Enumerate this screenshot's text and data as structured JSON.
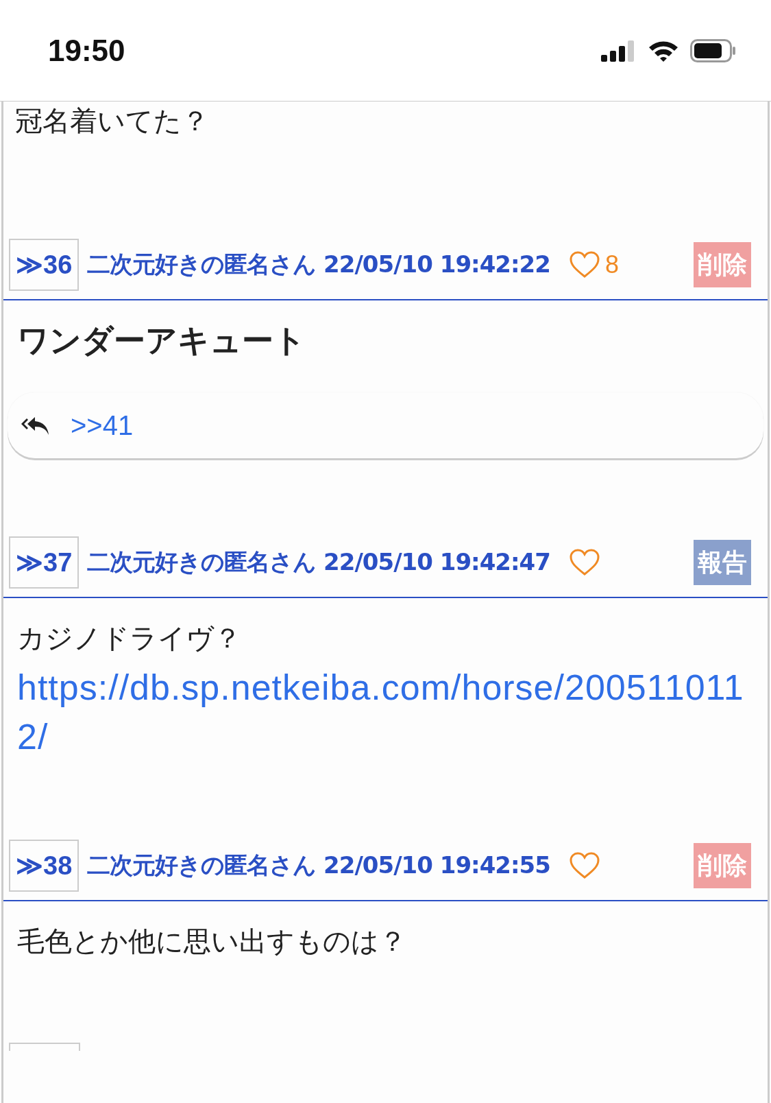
{
  "status_bar": {
    "time": "19:50"
  },
  "previous_post_tail": {
    "text": "冠名着いてた？"
  },
  "posts": [
    {
      "number": "≫36",
      "name": "二次元好きの匿名さん",
      "datetime": "22/05/10 19:42:22",
      "likes": "8",
      "action": {
        "kind": "delete",
        "label": "削除"
      },
      "bold": true,
      "body": [
        {
          "kind": "text",
          "text": "ワンダーアキュート"
        }
      ],
      "replies": [
        ">>41"
      ]
    },
    {
      "number": "≫37",
      "name": "二次元好きの匿名さん",
      "datetime": "22/05/10 19:42:47",
      "action": {
        "kind": "report",
        "label": "報告"
      },
      "bold": false,
      "body": [
        {
          "kind": "text",
          "text": "カジノドライヴ？"
        },
        {
          "kind": "link",
          "text": "https://db.sp.netkeiba.com/horse/2005110112/"
        }
      ]
    },
    {
      "number": "≫38",
      "name": "二次元好きの匿名さん",
      "datetime": "22/05/10 19:42:55",
      "action": {
        "kind": "delete",
        "label": "削除"
      },
      "bold": false,
      "body": [
        {
          "kind": "text",
          "text": "毛色とか他に思い出すものは？"
        }
      ]
    }
  ]
}
